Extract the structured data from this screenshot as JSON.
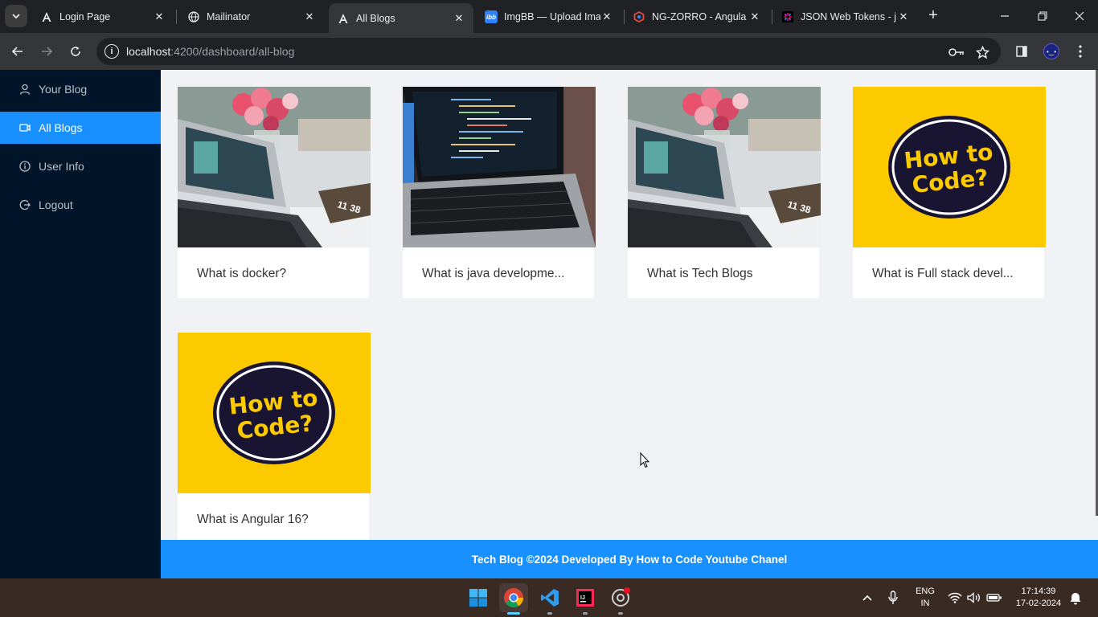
{
  "browser": {
    "tabs": [
      {
        "title": "Login Page",
        "icon": "angular-icon",
        "active": false
      },
      {
        "title": "Mailinator",
        "icon": "globe-icon",
        "active": false
      },
      {
        "title": "All Blogs",
        "icon": "angular-icon",
        "active": true
      },
      {
        "title": "ImgBB — Upload Ima",
        "icon": "imgbb-icon",
        "active": false
      },
      {
        "title": "NG-ZORRO - Angula",
        "icon": "ng-zorro-icon",
        "active": false
      },
      {
        "title": "JSON Web Tokens - j",
        "icon": "jwt-icon",
        "active": false
      }
    ],
    "url_host": "localhost",
    "url_path": ":4200/dashboard/all-blog"
  },
  "sidebar": {
    "items": [
      {
        "label": "Your Blog",
        "icon": "user-icon",
        "selected": false
      },
      {
        "label": "All Blogs",
        "icon": "video-icon",
        "selected": true
      },
      {
        "label": "User Info",
        "icon": "info-icon",
        "selected": false
      },
      {
        "label": "Logout",
        "icon": "logout-icon",
        "selected": false
      }
    ]
  },
  "blogs": [
    {
      "title": "What is docker?",
      "image": "laptop-flowers"
    },
    {
      "title": "What is java developme...",
      "image": "laptop-code"
    },
    {
      "title": "What is Tech Blogs",
      "image": "laptop-flowers"
    },
    {
      "title": "What is Full stack devel...",
      "image": "how-to-code-logo"
    },
    {
      "title": "What is Angular 16?",
      "image": "how-to-code-logo"
    }
  ],
  "logo_text": [
    "How to",
    "Code?"
  ],
  "footer": {
    "text": "Tech Blog ©2024 Developed By How to Code Youtube Chanel"
  },
  "taskbar": {
    "lang_top": "ENG",
    "lang_bottom": "IN",
    "time": "17:14:39",
    "date": "17-02-2024"
  },
  "colors": {
    "sider_bg": "#001529",
    "accent": "#1890ff",
    "content_bg": "#f0f2f5",
    "logo_yellow": "#fdca00",
    "logo_navy": "#1a1433"
  }
}
